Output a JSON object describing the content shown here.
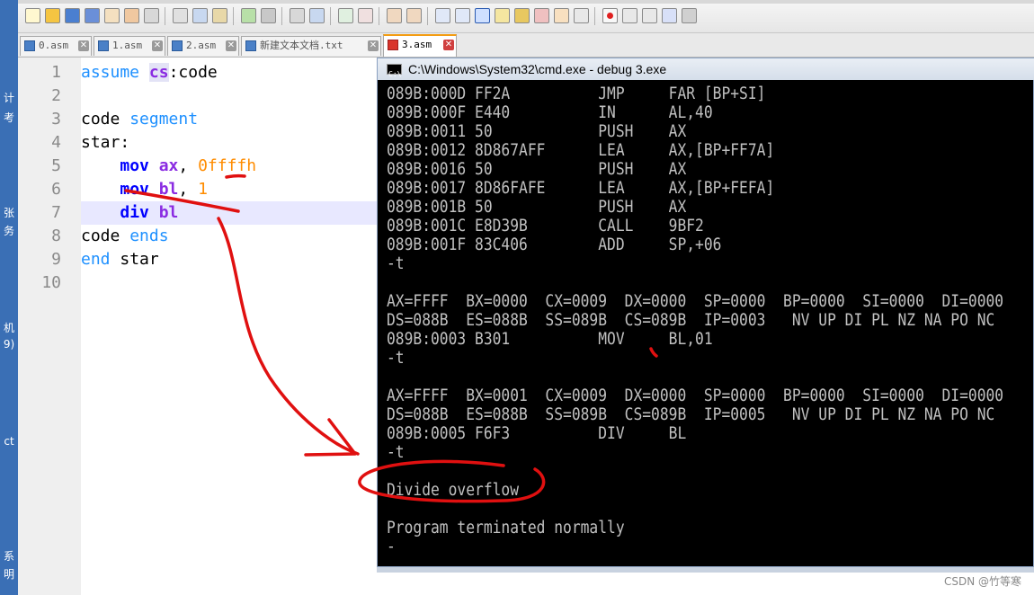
{
  "sidebar_fragments": [
    "计",
    "考",
    "张",
    "务",
    "机",
    "9)",
    "ct",
    "系",
    "明"
  ],
  "tabs": [
    {
      "label": "0.asm"
    },
    {
      "label": "1.asm"
    },
    {
      "label": "2.asm"
    },
    {
      "label": "新建文本文档.txt"
    },
    {
      "label": "3.asm"
    }
  ],
  "editor": {
    "line_numbers": [
      "1",
      "2",
      "3",
      "4",
      "5",
      "6",
      "7",
      "8",
      "9",
      "10"
    ],
    "lines": [
      {
        "tokens": [
          "assume",
          " ",
          "cs",
          ":code"
        ]
      },
      {
        "tokens": []
      },
      {
        "tokens": [
          "code",
          " ",
          "segment"
        ]
      },
      {
        "tokens": [
          "star:"
        ]
      },
      {
        "tokens": [
          "    ",
          "mov",
          " ",
          "ax",
          ", ",
          "0ffffh"
        ]
      },
      {
        "tokens": [
          "    ",
          "mov",
          " ",
          "bl",
          ", ",
          "1"
        ]
      },
      {
        "tokens": [
          "    ",
          "div",
          " ",
          "bl"
        ]
      },
      {
        "tokens": [
          "code",
          " ",
          "ends"
        ]
      },
      {
        "tokens": [
          "end",
          " ",
          "star"
        ]
      },
      {
        "tokens": []
      }
    ]
  },
  "cmd": {
    "title": "C:\\Windows\\System32\\cmd.exe - debug  3.exe",
    "lines": [
      "089B:000D FF2A          JMP     FAR [BP+SI]",
      "089B:000F E440          IN      AL,40",
      "089B:0011 50            PUSH    AX",
      "089B:0012 8D867AFF      LEA     AX,[BP+FF7A]",
      "089B:0016 50            PUSH    AX",
      "089B:0017 8D86FAFE      LEA     AX,[BP+FEFA]",
      "089B:001B 50            PUSH    AX",
      "089B:001C E8D39B        CALL    9BF2",
      "089B:001F 83C406        ADD     SP,+06",
      "-t",
      "",
      "AX=FFFF  BX=0000  CX=0009  DX=0000  SP=0000  BP=0000  SI=0000  DI=0000",
      "DS=088B  ES=088B  SS=089B  CS=089B  IP=0003   NV UP DI PL NZ NA PO NC",
      "089B:0003 B301          MOV     BL,01",
      "-t",
      "",
      "AX=FFFF  BX=0001  CX=0009  DX=0000  SP=0000  BP=0000  SI=0000  DI=0000",
      "DS=088B  ES=088B  SS=089B  CS=089B  IP=0005   NV UP DI PL NZ NA PO NC",
      "089B:0005 F6F3          DIV     BL",
      "-t",
      "",
      "Divide overflow",
      "",
      "Program terminated normally",
      "-"
    ]
  },
  "watermark": "CSDN @竹等寒",
  "colors": {
    "keyword_blue": "#1e90ff",
    "instruction_blue": "#0000ff",
    "register_purple": "#8a2be2",
    "number_orange": "#ff8c00",
    "annotation_red": "#e01010",
    "active_tab_accent": "#f39c12"
  }
}
